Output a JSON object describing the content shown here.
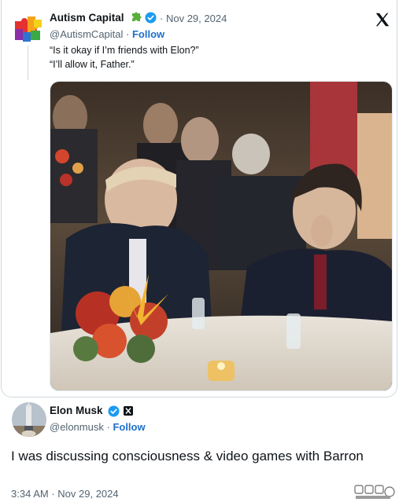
{
  "quoted_tweet": {
    "display_name": "Autism Capital",
    "badge_icon": "puzzle-piece-icon",
    "verified_icon": "verified-badge-icon",
    "separator": "·",
    "date": "Nov 29, 2024",
    "handle": "@AutismCapital",
    "follow_label": "Follow",
    "lines": [
      "“Is it okay if I’m friends with Elon?”",
      "“I’ll allow it, Father.”"
    ],
    "platform_icon": "x-logo-icon"
  },
  "main_tweet": {
    "display_name": "Elon Musk",
    "verified_icon": "verified-badge-icon",
    "affiliate_icon": "x-affiliate-badge-icon",
    "handle": "@elonmusk",
    "separator": "·",
    "follow_label": "Follow",
    "text": "I was discussing consciousness & video games with Barron",
    "time": "3:34 AM",
    "date": "Nov 29, 2024"
  },
  "colors": {
    "link": "#1d6fcb",
    "verified": "#1d9bf0",
    "muted_text": "#536471",
    "border": "#cfd9de"
  }
}
